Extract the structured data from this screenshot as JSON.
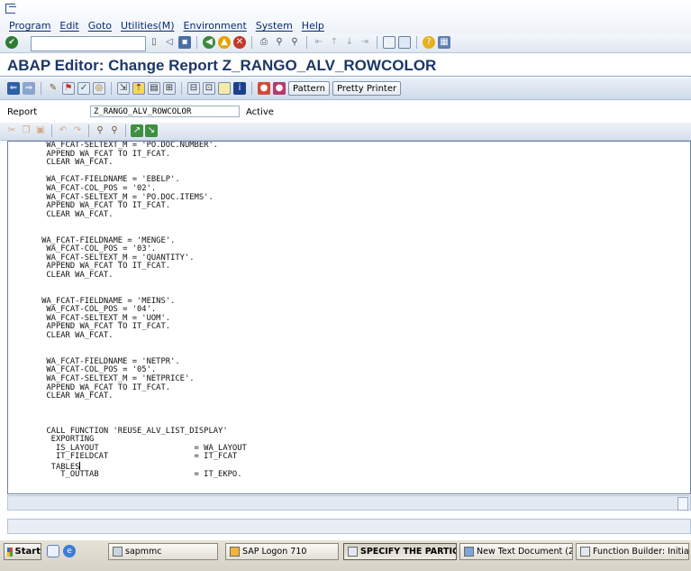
{
  "menu": {
    "items": [
      "Program",
      "Edit",
      "Goto",
      "Utilities(M)",
      "Environment",
      "System",
      "Help"
    ]
  },
  "toolbar": {
    "command_field_value": "",
    "icons": [
      "enter-icon",
      "save-icon",
      "back-icon",
      "exit-icon",
      "cancel-icon",
      "print-icon",
      "find-icon",
      "find-next-icon",
      "first-page-icon",
      "previous-page-icon",
      "next-page-icon",
      "last-page-icon",
      "create-session-icon",
      "shortcut-icon",
      "help-icon",
      "layout-icon"
    ]
  },
  "title": "ABAP Editor: Change Report Z_RANGO_ALV_ROWCOLOR",
  "app_toolbar": {
    "pattern_label": "Pattern",
    "pretty_printer_label": "Pretty Printer"
  },
  "report": {
    "label": "Report",
    "name": "Z_RANGO_ALV_ROWCOLOR",
    "status": "Active"
  },
  "code_lines": [
    "        WA_FCAT-SELTEXT_M = 'PO.DOC.NUMBER'.",
    "        APPEND WA_FCAT TO IT_FCAT.",
    "        CLEAR WA_FCAT.",
    "",
    "        WA_FCAT-FIELDNAME = 'EBELP'.",
    "        WA_FCAT-COL_POS = '02'.",
    "        WA_FCAT-SELTEXT_M = 'PO.DOC.ITEMS'.",
    "        APPEND WA_FCAT TO IT_FCAT.",
    "        CLEAR WA_FCAT.",
    "",
    "",
    "       WA_FCAT-FIELDNAME = 'MENGE'.",
    "        WA_FCAT-COL_POS = '03'.",
    "        WA_FCAT-SELTEXT_M = 'QUANTITY'.",
    "        APPEND WA_FCAT TO IT_FCAT.",
    "        CLEAR WA_FCAT.",
    "",
    "",
    "       WA_FCAT-FIELDNAME = 'MEINS'.",
    "        WA_FCAT-COL_POS = '04'.",
    "        WA_FCAT-SELTEXT_M = 'UOM'.",
    "        APPEND WA_FCAT TO IT_FCAT.",
    "        CLEAR WA_FCAT.",
    "",
    "",
    "        WA_FCAT-FIELDNAME = 'NETPR'.",
    "        WA_FCAT-COL_POS = '05'.",
    "        WA_FCAT-SELTEXT_M = 'NETPRICE'.",
    "        APPEND WA_FCAT TO IT_FCAT.",
    "        CLEAR WA_FCAT.",
    "",
    "",
    "",
    "        CALL FUNCTION 'REUSE_ALV_LIST_DISPLAY'",
    "         EXPORTING",
    "          IS_LAYOUT                    = WA_LAYOUT",
    "          IT_FIELDCAT                  = IT_FCAT",
    "         TABLES",
    "           T_OUTTAB                    = IT_EKPO."
  ],
  "taskbar": {
    "start_label": "Start",
    "tasks": [
      {
        "label": "sapmmc"
      },
      {
        "label": "SAP Logon 710"
      },
      {
        "label": "SPECIFY THE PARTICU..."
      },
      {
        "label": "New Text Document (2) ..."
      },
      {
        "label": "Function Builder: Initial S..."
      }
    ]
  }
}
